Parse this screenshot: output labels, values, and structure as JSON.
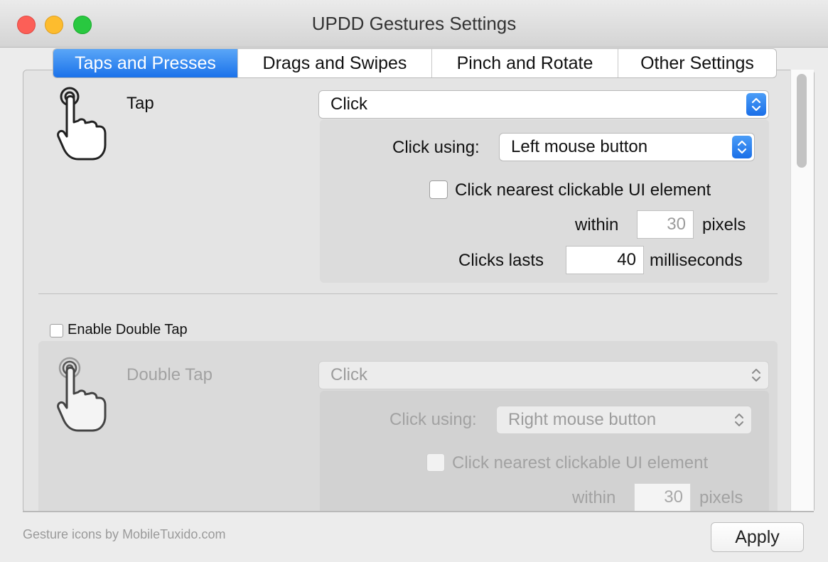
{
  "window": {
    "title": "UPDD Gestures Settings"
  },
  "tabs": [
    {
      "label": "Taps and Presses",
      "active": true
    },
    {
      "label": "Drags and Swipes",
      "active": false
    },
    {
      "label": "Pinch and Rotate",
      "active": false
    },
    {
      "label": "Other Settings",
      "active": false
    }
  ],
  "tap": {
    "label": "Tap",
    "action": "Click",
    "click_using_label": "Click using:",
    "click_using_value": "Left mouse button",
    "nearest_label": "Click nearest clickable UI element",
    "nearest_checked": false,
    "within_label": "within",
    "within_value": "30",
    "pixels_label": "pixels",
    "clicks_lasts_label": "Clicks lasts",
    "clicks_lasts_value": "40",
    "ms_label": "milliseconds"
  },
  "double_tap": {
    "enable_label": "Enable Double Tap",
    "enabled": false,
    "label": "Double Tap",
    "action": "Click",
    "click_using_label": "Click using:",
    "click_using_value": "Right mouse button",
    "nearest_label": "Click nearest clickable UI element",
    "within_label": "within",
    "within_value": "30",
    "pixels_label": "pixels"
  },
  "footer": {
    "credit": "Gesture icons by MobileTuxido.com",
    "apply_label": "Apply"
  },
  "colors": {
    "accent": "#1b72ea",
    "close": "#fc5f57",
    "minimize": "#fdbc2e",
    "maximize": "#29c840"
  }
}
